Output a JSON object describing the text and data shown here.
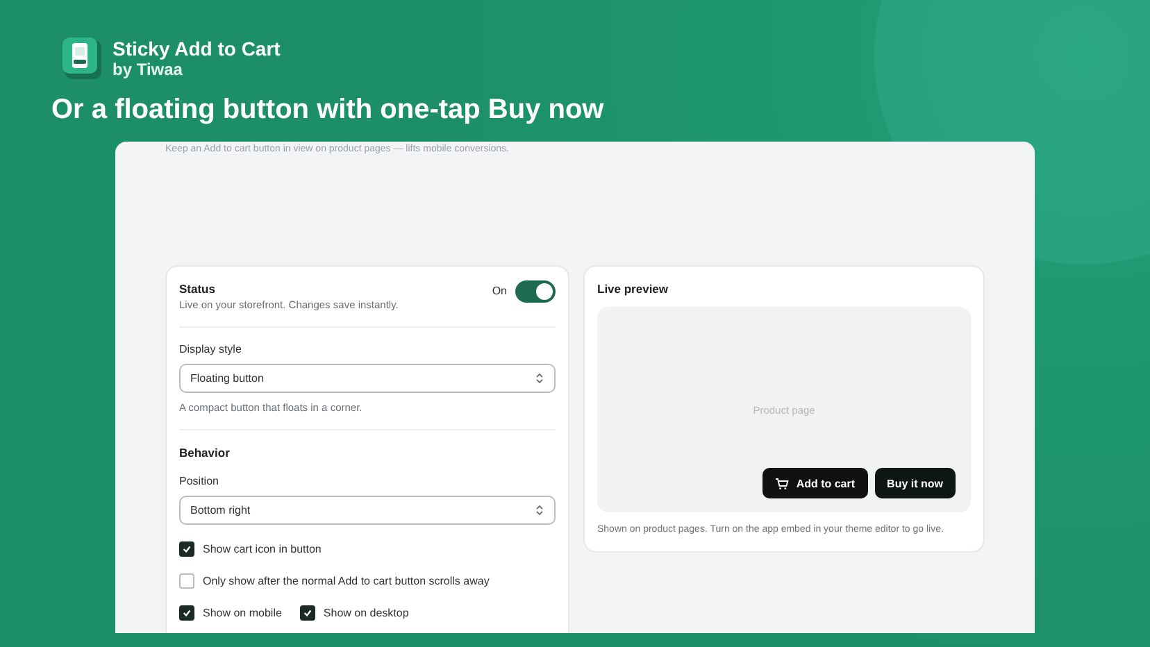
{
  "app": {
    "name": "Sticky Add to Cart",
    "vendor": "by Tiwaa"
  },
  "headline": "Or a floating button with one-tap Buy now",
  "intro": "Keep an Add to cart button in view on product pages — lifts mobile conversions.",
  "settings": {
    "status": {
      "title": "Status",
      "description": "Live on your storefront. Changes save instantly.",
      "label": "On",
      "on": true
    },
    "display_style": {
      "label": "Display style",
      "value": "Floating button",
      "help": "A compact button that floats in a corner."
    },
    "behavior": {
      "title": "Behavior",
      "position": {
        "label": "Position",
        "value": "Bottom right"
      },
      "options": [
        {
          "label": "Show cart icon in button",
          "checked": true
        },
        {
          "label": "Only show after the normal Add to cart button scrolls away",
          "checked": false
        }
      ],
      "devices": [
        {
          "label": "Show on mobile",
          "checked": true
        },
        {
          "label": "Show on desktop",
          "checked": true
        }
      ]
    }
  },
  "preview": {
    "title": "Live preview",
    "placeholder": "Product page",
    "add_button": "Add to cart",
    "buy_button": "Buy it now",
    "note": "Shown on product pages. Turn on the app embed in your theme editor to go live."
  }
}
